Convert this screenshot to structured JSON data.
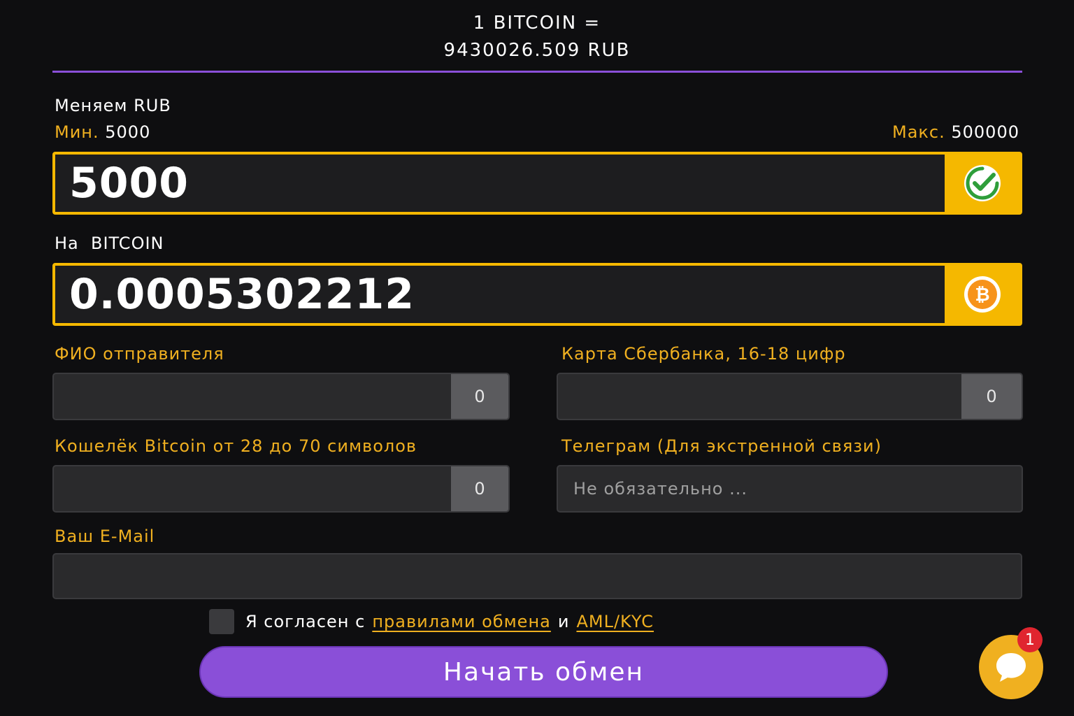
{
  "rate": {
    "line1": "1 BITCOIN =",
    "line2": "9430026.509 RUB"
  },
  "give": {
    "label": "Меняем RUB",
    "min_label": "Мин.",
    "min_value": "5000",
    "max_label": "Макс.",
    "max_value": "500000",
    "amount": "5000",
    "status_icon": "check-circle-icon"
  },
  "receive": {
    "label": "На  BITCOIN",
    "amount": "0.0005302212",
    "currency_icon": "bitcoin-icon"
  },
  "form": {
    "sender_name": {
      "label": "ФИО отправителя",
      "value": "",
      "counter": "0"
    },
    "card": {
      "label": "Карта Сбербанка, 16-18 цифр",
      "value": "",
      "counter": "0"
    },
    "wallet": {
      "label": "Кошелёк Bitcoin от 28 до 70 символов",
      "value": "",
      "counter": "0"
    },
    "telegram": {
      "label": "Телеграм (Для экстренной связи)",
      "value": "",
      "placeholder": "Не обязательно ..."
    },
    "email": {
      "label": "Ваш E-Mail",
      "value": ""
    }
  },
  "agreement": {
    "prefix": "Я согласен с",
    "rules_link": "правилами обмена",
    "conjunction": "и",
    "aml_link": "AML/KYC",
    "checked": false
  },
  "submit_label": "Начать обмен",
  "chat": {
    "icon": "chat-bubble-icon",
    "badge_count": "1"
  },
  "colors": {
    "background": "#0e0e10",
    "accent_gold": "#f5b800",
    "label_gold": "#f0b020",
    "purple": "#8a4fd8",
    "badge_red": "#e0252f",
    "check_green": "#2e9e3a",
    "bitcoin_orange": "#f7931a"
  }
}
